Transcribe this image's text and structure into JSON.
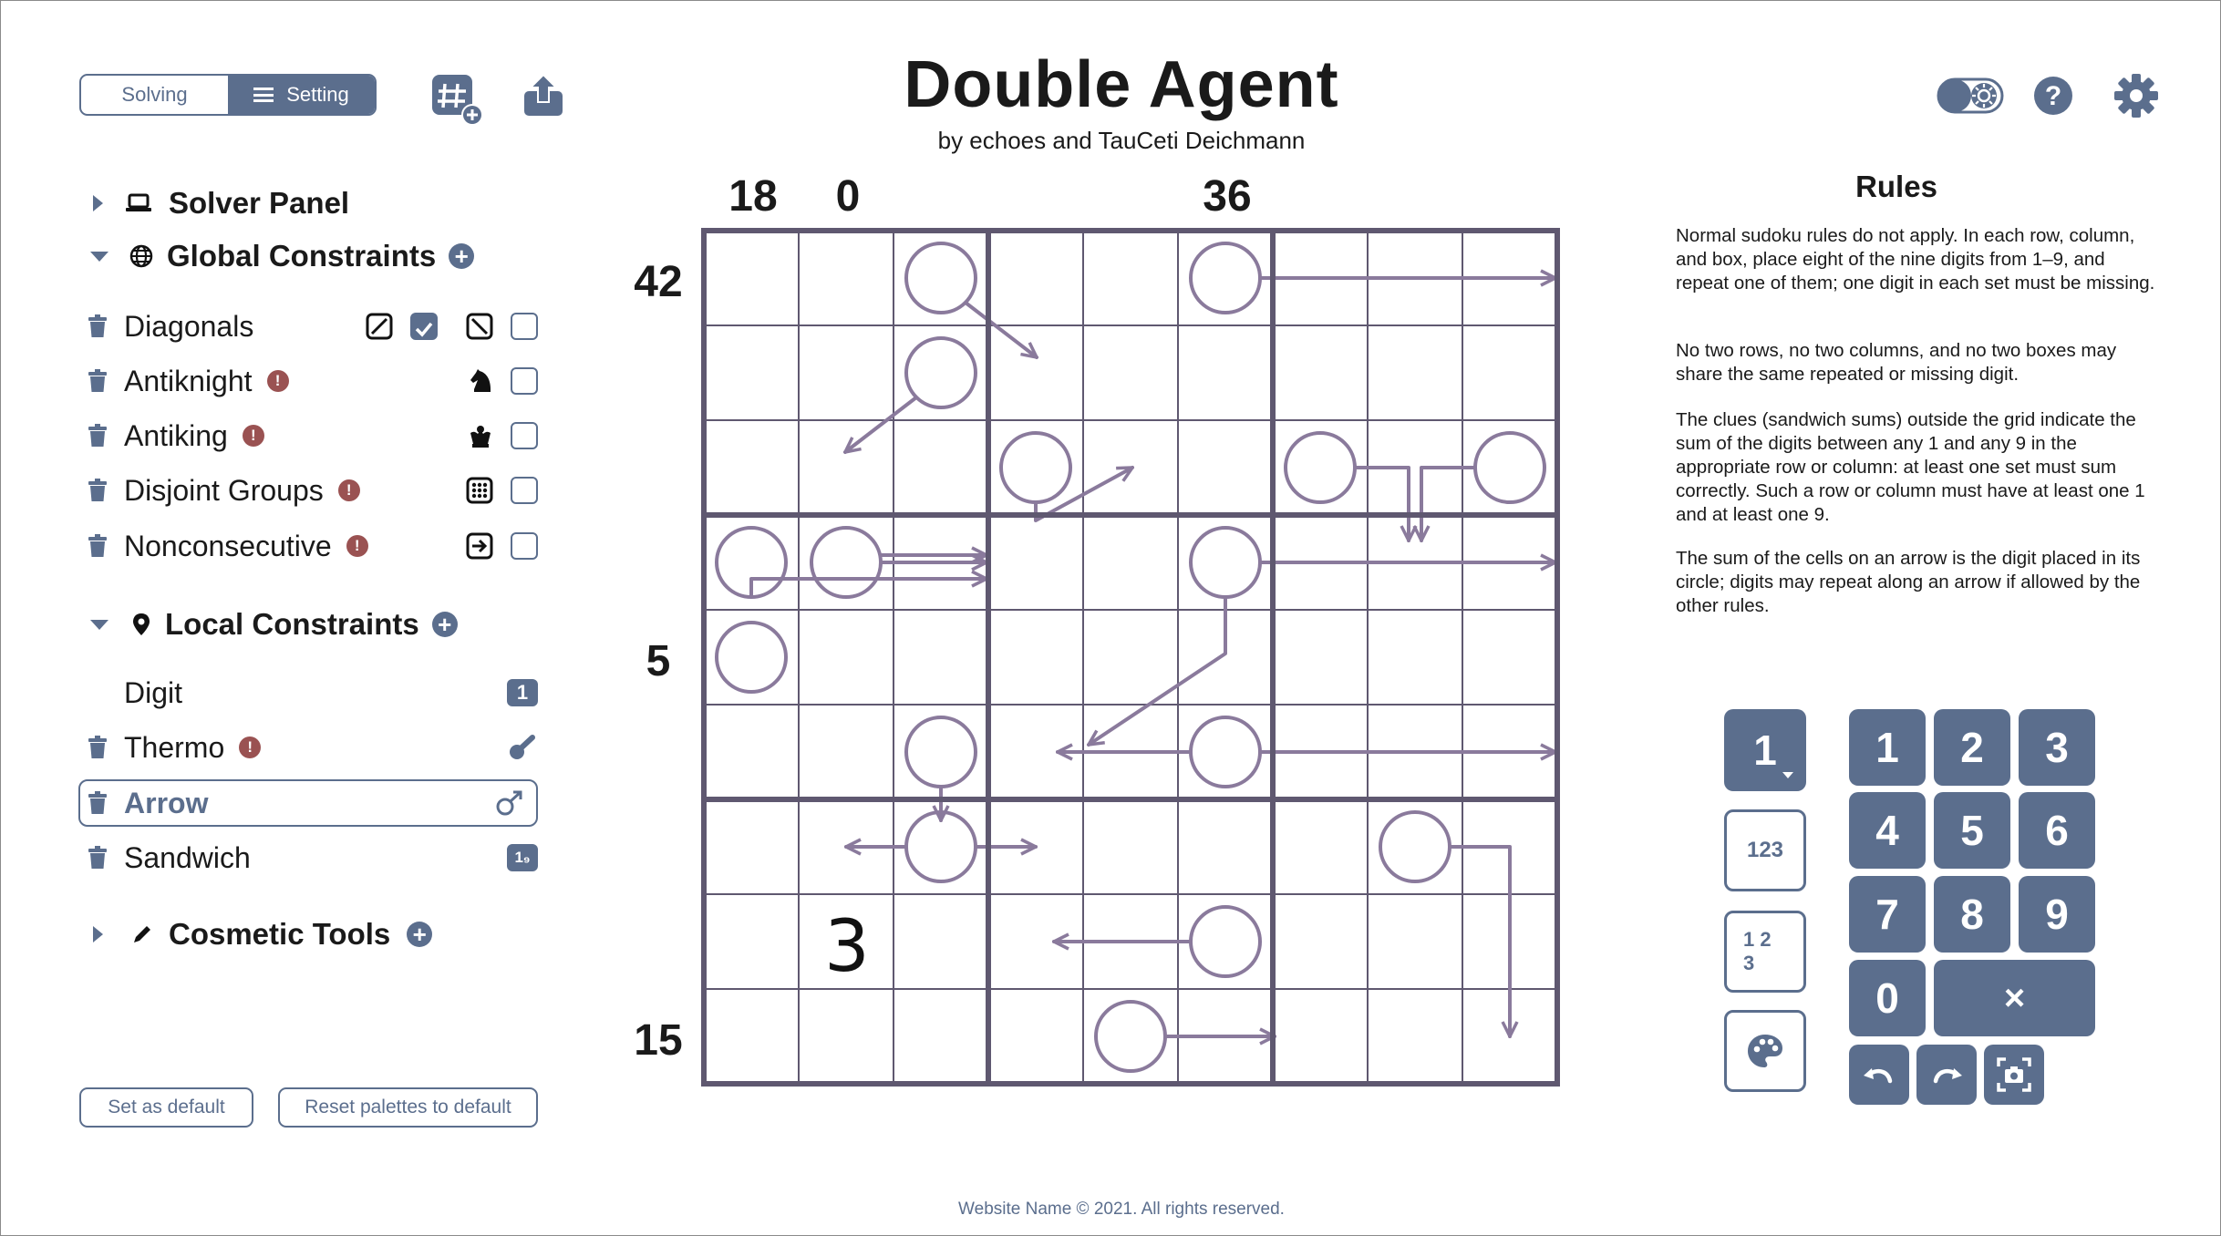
{
  "header": {
    "mode_solving": "Solving",
    "mode_setting": "Setting",
    "title": "Double Agent",
    "byline": "by echoes and TauCeti Deichmann"
  },
  "sidebar": {
    "solver_panel": "Solver Panel",
    "global_constraints": "Global Constraints",
    "global_items": [
      {
        "label": "Diagonals",
        "warn": false
      },
      {
        "label": "Antiknight",
        "warn": true
      },
      {
        "label": "Antiking",
        "warn": true
      },
      {
        "label": "Disjoint Groups",
        "warn": true
      },
      {
        "label": "Nonconsecutive",
        "warn": true
      }
    ],
    "local_constraints": "Local Constraints",
    "local_items": [
      {
        "label": "Digit",
        "tag": "1"
      },
      {
        "label": "Thermo"
      },
      {
        "label": "Arrow"
      },
      {
        "label": "Sandwich",
        "tag": "1₉"
      }
    ],
    "cosmetic_tools": "Cosmetic Tools",
    "set_default": "Set as default",
    "reset_palettes": "Reset palettes to default",
    "warn_glyph": "!"
  },
  "puzzle": {
    "col_clues": [
      "18",
      "0",
      "36"
    ],
    "row_clues": [
      "42",
      "5",
      "15"
    ],
    "given_digit": "3",
    "line_color": "#8a7a9c",
    "grid_color": "#5f5870"
  },
  "rules": {
    "title": "Rules",
    "p1": "Normal sudoku rules do not apply. In each row, column, and box, place eight of the nine digits from 1–9, and repeat one of them; one digit in each set must be missing.",
    "p2": "No two rows, no two columns, and no two boxes may share the same repeated or missing digit.",
    "p3": "The clues (sandwich sums) outside the grid indicate the sum of the digits between any 1 and any 9 in the appropriate row or column: at least one set must sum correctly. Such a row or column must have at least one 1 and at least one 9.",
    "p4": "The sum of the cells on an arrow is the digit placed in its circle; digits may repeat along an arrow if allowed by the other rules."
  },
  "keypad": {
    "mode_big": "1",
    "mode_center": "123",
    "mode_corner_1": "1 2",
    "mode_corner_2": "3",
    "digits": [
      "1",
      "2",
      "3",
      "4",
      "5",
      "6",
      "7",
      "8",
      "9",
      "0"
    ],
    "delete": "×"
  },
  "footer": "Website Name © 2021. All rights reserved."
}
